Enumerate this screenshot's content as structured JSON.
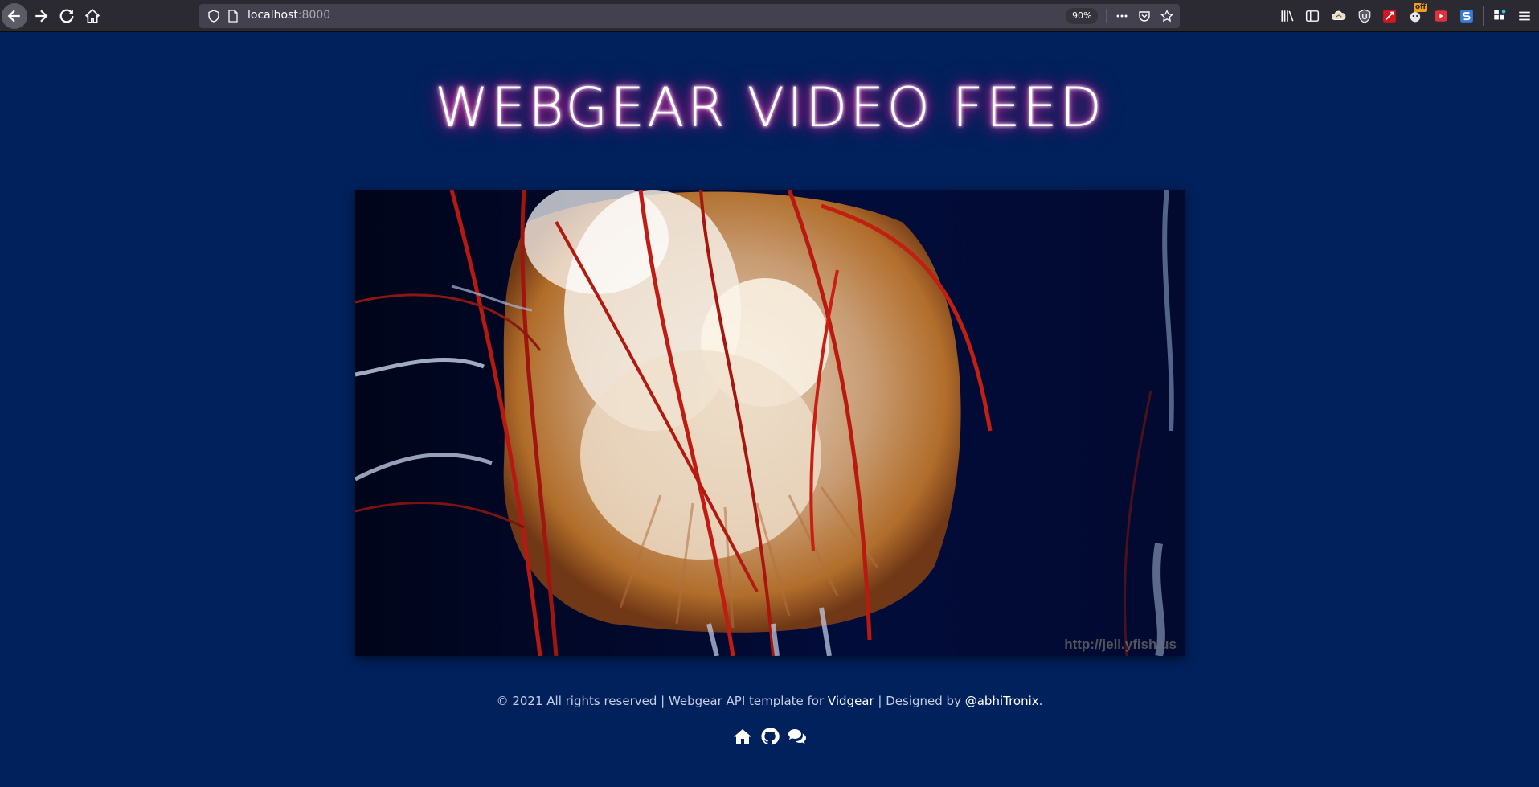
{
  "browser": {
    "url_host": "localhost",
    "url_port": ":8000",
    "zoom": "90%",
    "extension_badge": "off"
  },
  "page": {
    "title": "WEBGEAR VIDEO FEED",
    "video": {
      "watermark": "http://jell.yfish.us"
    },
    "footer": {
      "copyright": "© 2021 All rights reserved | Webgear API template for ",
      "vidgear_link": "Vidgear",
      "designed_by": " | Designed by ",
      "author_link": "@abhiTronix",
      "end": "."
    },
    "footer_icons": [
      "home-icon",
      "github-icon",
      "comments-icon"
    ]
  },
  "colors": {
    "page_background": "#00215c",
    "title_glow": "#e0107f",
    "toolbar": "#2b2a33"
  }
}
